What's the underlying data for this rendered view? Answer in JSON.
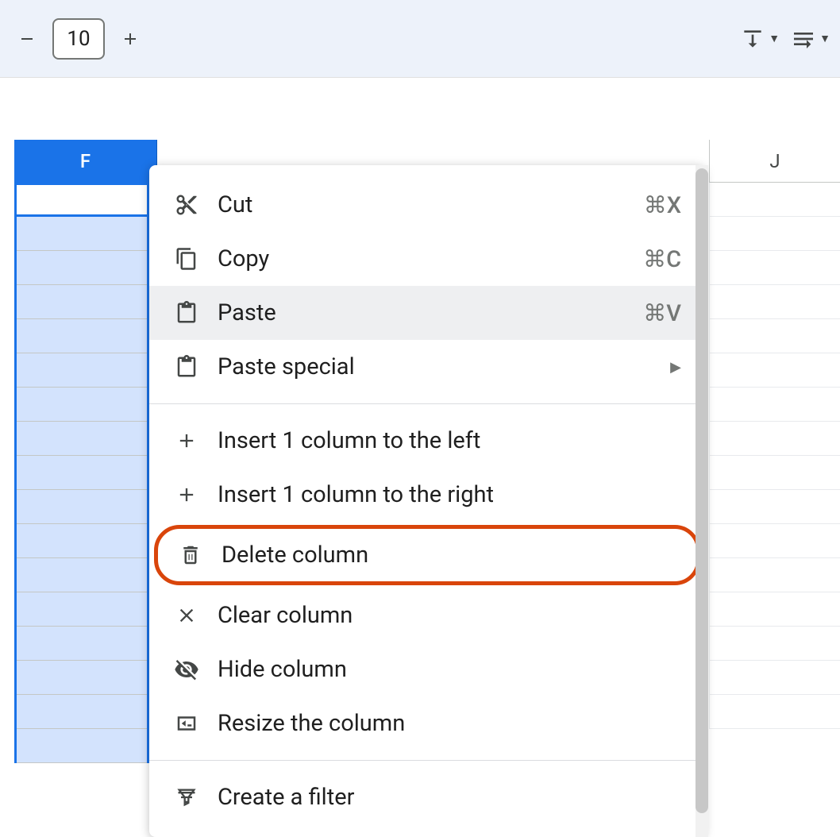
{
  "toolbar": {
    "font_size": "10",
    "decrease_icon": "minus-icon",
    "increase_icon": "plus-icon"
  },
  "column_headers": {
    "selected": "F",
    "visible_right": "J"
  },
  "context_menu": {
    "cut": {
      "label": "Cut",
      "shortcut": "⌘X"
    },
    "copy": {
      "label": "Copy",
      "shortcut": "⌘C"
    },
    "paste": {
      "label": "Paste",
      "shortcut": "⌘V"
    },
    "paste_special": {
      "label": "Paste special"
    },
    "insert_left": {
      "label": "Insert 1 column to the left"
    },
    "insert_right": {
      "label": "Insert 1 column to the right"
    },
    "delete_column": {
      "label": "Delete column"
    },
    "clear_column": {
      "label": "Clear column"
    },
    "hide_column": {
      "label": "Hide column"
    },
    "resize_column": {
      "label": "Resize the column"
    },
    "create_filter": {
      "label": "Create a filter"
    }
  }
}
